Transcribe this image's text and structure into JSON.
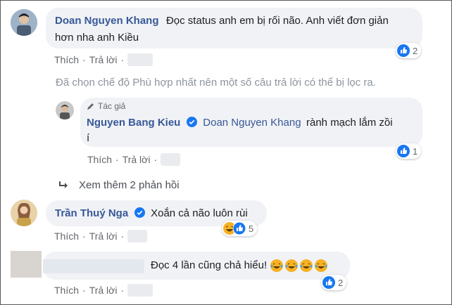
{
  "colors": {
    "link_blue": "#385898",
    "meta_gray": "#65676b",
    "bubble_bg": "#f0f2f5",
    "like_blue": "#1877f2",
    "haha_yellow": "#f7b125"
  },
  "comment1": {
    "author": "Doan Nguyen Khang",
    "text_line1": "Đọc status anh em bị rối não. Anh viết đơn giản",
    "text_line2": "hơn nha anh Kiều",
    "like_label": "Thích",
    "reply_label": "Trả lời",
    "reaction_count": "2",
    "reaction_icon": "like-icon"
  },
  "filter_notice": "Đã chọn chế độ Phù hợp nhất nên một số câu trả lời có thể bị lọc ra.",
  "reply1": {
    "author_badge": "Tác giả",
    "author": "Nguyen Bang Kieu",
    "mention": "Doan Nguyen Khang",
    "text_tail": "rành mạch lắm zồi",
    "text_line2": "í",
    "like_label": "Thích",
    "reply_label": "Trả lời",
    "reaction_count": "1",
    "reaction_icon": "like-icon"
  },
  "see_more": "Xem thêm 2 phản hồi",
  "comment2": {
    "author": "Trần Thuý Nga",
    "text": "Xoắn cả não luôn rùi",
    "like_label": "Thích",
    "reply_label": "Trả lời",
    "reaction_count": "5",
    "reaction_icons": [
      "haha-icon",
      "like-icon"
    ]
  },
  "comment3": {
    "text": "Đọc 4 lần cũng chả hiểu!",
    "emoji": "laughing-tears-icon",
    "like_label": "Thích",
    "reply_label": "Trả lời",
    "reaction_count": "2",
    "reaction_icon": "like-icon"
  }
}
